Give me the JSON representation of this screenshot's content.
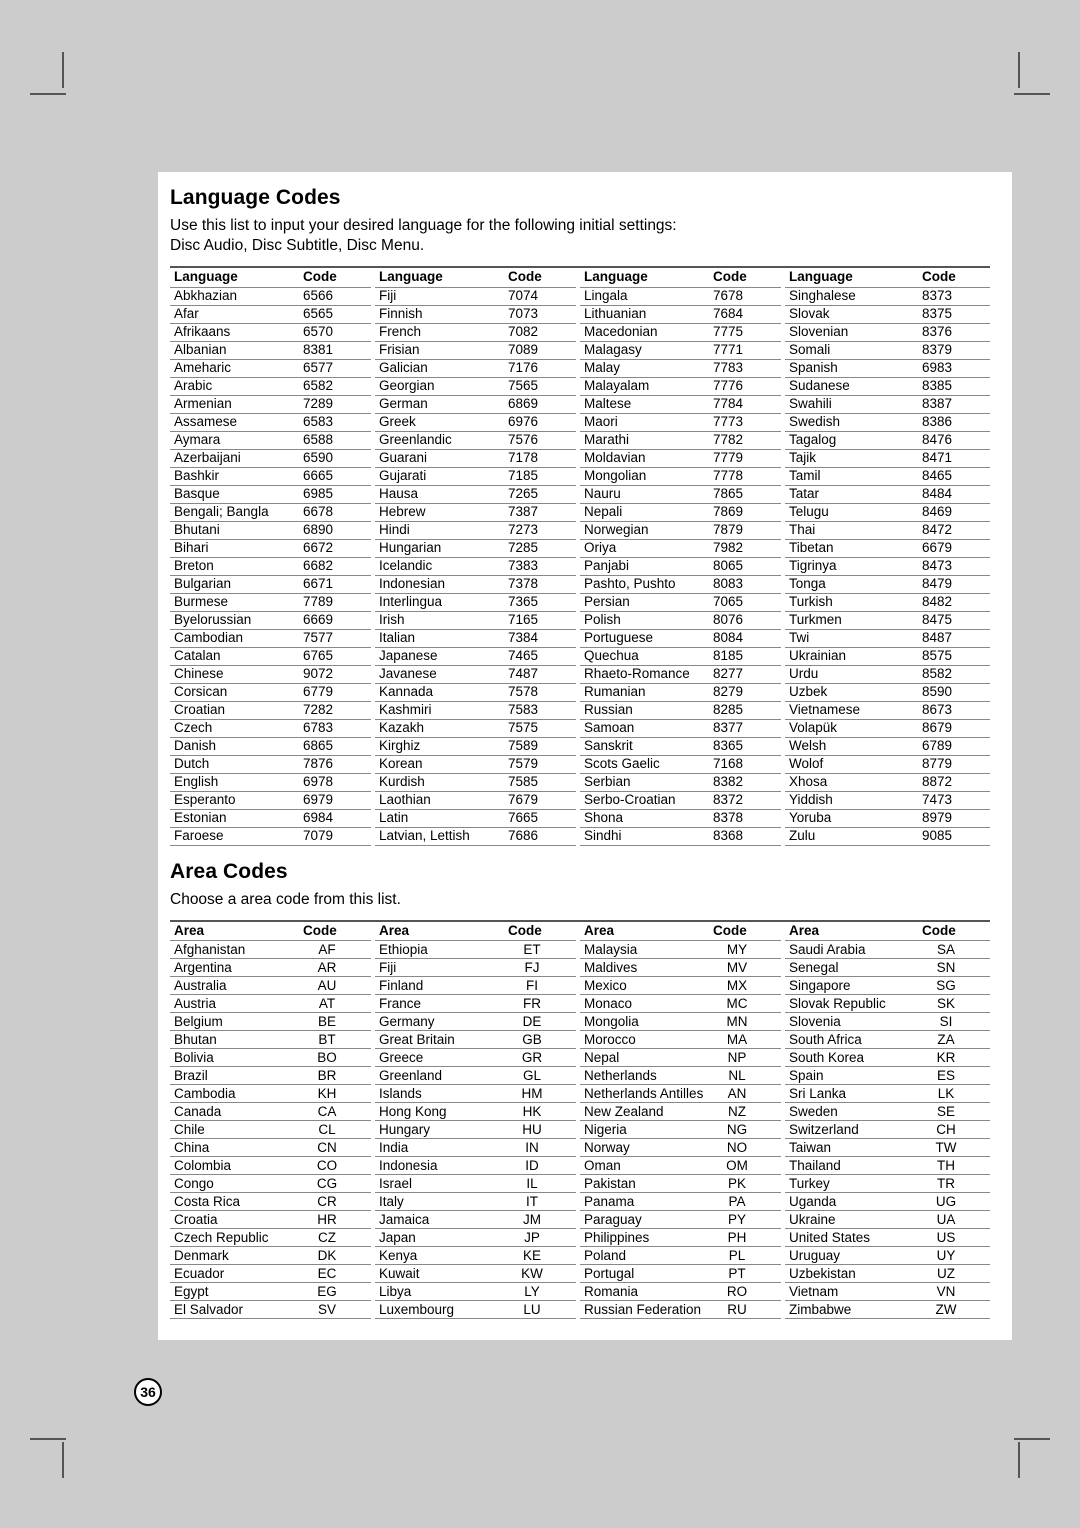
{
  "page": {
    "number": "36"
  },
  "language_section": {
    "title": "Language Codes",
    "description_line1": "Use this list to input your desired language for the following initial settings:",
    "description_line2": "Disc Audio, Disc Subtitle, Disc Menu.",
    "headers": {
      "name": "Language",
      "code": "Code"
    },
    "columns": [
      [
        [
          "Abkhazian",
          "6566"
        ],
        [
          "Afar",
          "6565"
        ],
        [
          "Afrikaans",
          "6570"
        ],
        [
          "Albanian",
          "8381"
        ],
        [
          "Ameharic",
          "6577"
        ],
        [
          "Arabic",
          "6582"
        ],
        [
          "Armenian",
          "7289"
        ],
        [
          "Assamese",
          "6583"
        ],
        [
          "Aymara",
          "6588"
        ],
        [
          "Azerbaijani",
          "6590"
        ],
        [
          "Bashkir",
          "6665"
        ],
        [
          "Basque",
          "6985"
        ],
        [
          "Bengali; Bangla",
          "6678"
        ],
        [
          "Bhutani",
          "6890"
        ],
        [
          "Bihari",
          "6672"
        ],
        [
          "Breton",
          "6682"
        ],
        [
          "Bulgarian",
          "6671"
        ],
        [
          "Burmese",
          "7789"
        ],
        [
          "Byelorussian",
          "6669"
        ],
        [
          "Cambodian",
          "7577"
        ],
        [
          "Catalan",
          "6765"
        ],
        [
          "Chinese",
          "9072"
        ],
        [
          "Corsican",
          "6779"
        ],
        [
          "Croatian",
          "7282"
        ],
        [
          "Czech",
          "6783"
        ],
        [
          "Danish",
          "6865"
        ],
        [
          "Dutch",
          "7876"
        ],
        [
          "English",
          "6978"
        ],
        [
          "Esperanto",
          "6979"
        ],
        [
          "Estonian",
          "6984"
        ],
        [
          "Faroese",
          "7079"
        ]
      ],
      [
        [
          "Fiji",
          "7074"
        ],
        [
          "Finnish",
          "7073"
        ],
        [
          "French",
          "7082"
        ],
        [
          "Frisian",
          "7089"
        ],
        [
          "Galician",
          "7176"
        ],
        [
          "Georgian",
          "7565"
        ],
        [
          "German",
          "6869"
        ],
        [
          "Greek",
          "6976"
        ],
        [
          "Greenlandic",
          "7576"
        ],
        [
          "Guarani",
          "7178"
        ],
        [
          "Gujarati",
          "7185"
        ],
        [
          "Hausa",
          "7265"
        ],
        [
          "Hebrew",
          "7387"
        ],
        [
          "Hindi",
          "7273"
        ],
        [
          "Hungarian",
          "7285"
        ],
        [
          "Icelandic",
          "7383"
        ],
        [
          "Indonesian",
          "7378"
        ],
        [
          "Interlingua",
          "7365"
        ],
        [
          "Irish",
          "7165"
        ],
        [
          "Italian",
          "7384"
        ],
        [
          "Japanese",
          "7465"
        ],
        [
          "Javanese",
          "7487"
        ],
        [
          "Kannada",
          "7578"
        ],
        [
          "Kashmiri",
          "7583"
        ],
        [
          "Kazakh",
          "7575"
        ],
        [
          "Kirghiz",
          "7589"
        ],
        [
          "Korean",
          "7579"
        ],
        [
          "Kurdish",
          "7585"
        ],
        [
          "Laothian",
          "7679"
        ],
        [
          "Latin",
          "7665"
        ],
        [
          "Latvian, Lettish",
          "7686"
        ]
      ],
      [
        [
          "Lingala",
          "7678"
        ],
        [
          "Lithuanian",
          "7684"
        ],
        [
          "Macedonian",
          "7775"
        ],
        [
          "Malagasy",
          "7771"
        ],
        [
          "Malay",
          "7783"
        ],
        [
          "Malayalam",
          "7776"
        ],
        [
          "Maltese",
          "7784"
        ],
        [
          "Maori",
          "7773"
        ],
        [
          "Marathi",
          "7782"
        ],
        [
          "Moldavian",
          "7779"
        ],
        [
          "Mongolian",
          "7778"
        ],
        [
          "Nauru",
          "7865"
        ],
        [
          "Nepali",
          "7869"
        ],
        [
          "Norwegian",
          "7879"
        ],
        [
          "Oriya",
          "7982"
        ],
        [
          "Panjabi",
          "8065"
        ],
        [
          "Pashto, Pushto",
          "8083"
        ],
        [
          "Persian",
          "7065"
        ],
        [
          "Polish",
          "8076"
        ],
        [
          "Portuguese",
          "8084"
        ],
        [
          "Quechua",
          "8185"
        ],
        [
          "Rhaeto-Romance",
          "8277"
        ],
        [
          "Rumanian",
          "8279"
        ],
        [
          "Russian",
          "8285"
        ],
        [
          "Samoan",
          "8377"
        ],
        [
          "Sanskrit",
          "8365"
        ],
        [
          "Scots Gaelic",
          "7168"
        ],
        [
          "Serbian",
          "8382"
        ],
        [
          "Serbo-Croatian",
          "8372"
        ],
        [
          "Shona",
          "8378"
        ],
        [
          "Sindhi",
          "8368"
        ]
      ],
      [
        [
          "Singhalese",
          "8373"
        ],
        [
          "Slovak",
          "8375"
        ],
        [
          "Slovenian",
          "8376"
        ],
        [
          "Somali",
          "8379"
        ],
        [
          "Spanish",
          "6983"
        ],
        [
          "Sudanese",
          "8385"
        ],
        [
          "Swahili",
          "8387"
        ],
        [
          "Swedish",
          "8386"
        ],
        [
          "Tagalog",
          "8476"
        ],
        [
          "Tajik",
          "8471"
        ],
        [
          "Tamil",
          "8465"
        ],
        [
          "Tatar",
          "8484"
        ],
        [
          "Telugu",
          "8469"
        ],
        [
          "Thai",
          "8472"
        ],
        [
          "Tibetan",
          "6679"
        ],
        [
          "Tigrinya",
          "8473"
        ],
        [
          "Tonga",
          "8479"
        ],
        [
          "Turkish",
          "8482"
        ],
        [
          "Turkmen",
          "8475"
        ],
        [
          "Twi",
          "8487"
        ],
        [
          "Ukrainian",
          "8575"
        ],
        [
          "Urdu",
          "8582"
        ],
        [
          "Uzbek",
          "8590"
        ],
        [
          "Vietnamese",
          "8673"
        ],
        [
          "Volapük",
          "8679"
        ],
        [
          "Welsh",
          "6789"
        ],
        [
          "Wolof",
          "8779"
        ],
        [
          "Xhosa",
          "8872"
        ],
        [
          "Yiddish",
          "7473"
        ],
        [
          "Yoruba",
          "8979"
        ],
        [
          "Zulu",
          "9085"
        ]
      ]
    ]
  },
  "area_section": {
    "title": "Area Codes",
    "description_line1": "Choose a area code from this list.",
    "headers": {
      "name": "Area",
      "code": "Code"
    },
    "columns": [
      [
        [
          "Afghanistan",
          "AF"
        ],
        [
          "Argentina",
          "AR"
        ],
        [
          "Australia",
          "AU"
        ],
        [
          "Austria",
          "AT"
        ],
        [
          "Belgium",
          "BE"
        ],
        [
          "Bhutan",
          "BT"
        ],
        [
          "Bolivia",
          "BO"
        ],
        [
          "Brazil",
          "BR"
        ],
        [
          "Cambodia",
          "KH"
        ],
        [
          "Canada",
          "CA"
        ],
        [
          "Chile",
          "CL"
        ],
        [
          "China",
          "CN"
        ],
        [
          "Colombia",
          "CO"
        ],
        [
          "Congo",
          "CG"
        ],
        [
          "Costa Rica",
          "CR"
        ],
        [
          "Croatia",
          "HR"
        ],
        [
          "Czech Republic",
          "CZ"
        ],
        [
          "Denmark",
          "DK"
        ],
        [
          "Ecuador",
          "EC"
        ],
        [
          "Egypt",
          "EG"
        ],
        [
          "El Salvador",
          "SV"
        ]
      ],
      [
        [
          "Ethiopia",
          "ET"
        ],
        [
          "Fiji",
          "FJ"
        ],
        [
          "Finland",
          "FI"
        ],
        [
          "France",
          "FR"
        ],
        [
          "Germany",
          "DE"
        ],
        [
          "Great Britain",
          "GB"
        ],
        [
          "Greece",
          "GR"
        ],
        [
          "Greenland",
          "GL"
        ],
        [
          "Islands",
          "HM"
        ],
        [
          "Hong Kong",
          "HK"
        ],
        [
          "Hungary",
          "HU"
        ],
        [
          "India",
          "IN"
        ],
        [
          "Indonesia",
          "ID"
        ],
        [
          "Israel",
          "IL"
        ],
        [
          "Italy",
          "IT"
        ],
        [
          "Jamaica",
          "JM"
        ],
        [
          "Japan",
          "JP"
        ],
        [
          "Kenya",
          "KE"
        ],
        [
          "Kuwait",
          "KW"
        ],
        [
          "Libya",
          "LY"
        ],
        [
          "Luxembourg",
          "LU"
        ]
      ],
      [
        [
          "Malaysia",
          "MY"
        ],
        [
          "Maldives",
          "MV"
        ],
        [
          "Mexico",
          "MX"
        ],
        [
          "Monaco",
          "MC"
        ],
        [
          "Mongolia",
          "MN"
        ],
        [
          "Morocco",
          "MA"
        ],
        [
          "Nepal",
          "NP"
        ],
        [
          "Netherlands",
          "NL"
        ],
        [
          "Netherlands Antilles",
          "AN"
        ],
        [
          "New Zealand",
          "NZ"
        ],
        [
          "Nigeria",
          "NG"
        ],
        [
          "Norway",
          "NO"
        ],
        [
          "Oman",
          "OM"
        ],
        [
          "Pakistan",
          "PK"
        ],
        [
          "Panama",
          "PA"
        ],
        [
          "Paraguay",
          "PY"
        ],
        [
          "Philippines",
          "PH"
        ],
        [
          "Poland",
          "PL"
        ],
        [
          "Portugal",
          "PT"
        ],
        [
          "Romania",
          "RO"
        ],
        [
          "Russian Federation",
          "RU"
        ]
      ],
      [
        [
          "Saudi Arabia",
          "SA"
        ],
        [
          "Senegal",
          "SN"
        ],
        [
          "Singapore",
          "SG"
        ],
        [
          "Slovak Republic",
          "SK"
        ],
        [
          "Slovenia",
          "SI"
        ],
        [
          "South Africa",
          "ZA"
        ],
        [
          "South Korea",
          "KR"
        ],
        [
          "Spain",
          "ES"
        ],
        [
          "Sri Lanka",
          "LK"
        ],
        [
          "Sweden",
          "SE"
        ],
        [
          "Switzerland",
          "CH"
        ],
        [
          "Taiwan",
          "TW"
        ],
        [
          "Thailand",
          "TH"
        ],
        [
          "Turkey",
          "TR"
        ],
        [
          "Uganda",
          "UG"
        ],
        [
          "Ukraine",
          "UA"
        ],
        [
          "United States",
          "US"
        ],
        [
          "Uruguay",
          "UY"
        ],
        [
          "Uzbekistan",
          "UZ"
        ],
        [
          "Vietnam",
          "VN"
        ],
        [
          "Zimbabwe",
          "ZW"
        ]
      ]
    ]
  }
}
